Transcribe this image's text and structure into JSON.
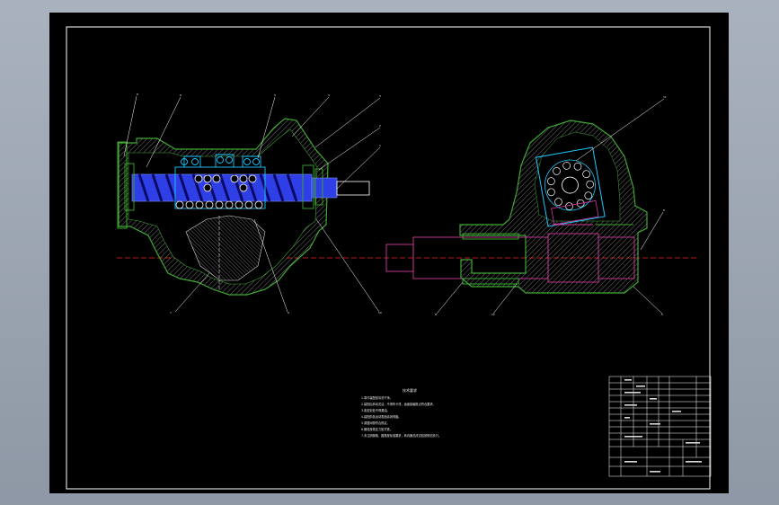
{
  "sheet": {
    "background": "#000000",
    "frame_color": "#ffffff",
    "centerline_color": "#ff2020",
    "housing_color": "#3ea832",
    "worm_color": "#2f3fe6",
    "nut_color": "#1ec8ff",
    "shaft_color": "#d3389e",
    "hatch_color": "#c8c8c8"
  },
  "left_view_callouts": [
    "8",
    "6",
    "5",
    "4",
    "3",
    "2",
    "1",
    "7",
    "9",
    "10"
  ],
  "right_view_callouts": [
    "11",
    "6",
    "8",
    "12",
    "5"
  ],
  "notes": {
    "title": "技术要求",
    "lines": [
      "1.零件装配前清洗干净。",
      "2.装配后转动灵活，不得有卡滞，齿面接触斑点符合要求。",
      "3.各密封处不得漏油。",
      "4.装配前各运动表面涂润滑脂。",
      "5.调整间隙符合规定。",
      "6.螺栓按规定力矩拧紧。",
      "7.未注明倒角、圆角按标准要求，转向器总成试验按规范执行。"
    ]
  },
  "title_block": {
    "rows": [
      "",
      "",
      "",
      "",
      "",
      "",
      "",
      "",
      "",
      ""
    ]
  }
}
